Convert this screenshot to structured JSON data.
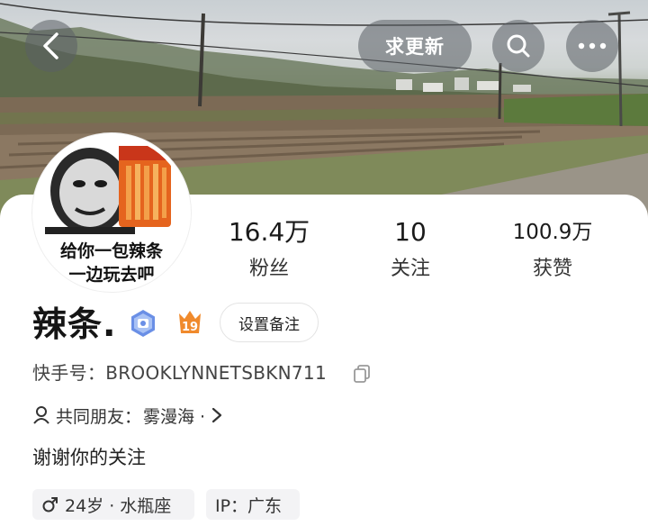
{
  "header": {
    "back_icon": "back-arrow-icon",
    "update_label": "求更新",
    "search_icon": "search-icon",
    "more_icon": "more-dots-icon"
  },
  "avatar": {
    "caption_line1": "给你一包辣条",
    "caption_line2": "一边玩去吧"
  },
  "stats": {
    "fans_value": "16.4万",
    "fans_label": "粉丝",
    "following_value": "10",
    "following_label": "关注",
    "likes_value": "100.9万",
    "likes_label": "获赞"
  },
  "profile": {
    "name": "辣条.",
    "level_badge": "19",
    "remark_button": "设置备注",
    "kwai_id_label": "快手号：",
    "kwai_id_value": "BROOKLYNNETSBKN711",
    "mutual_friends_label": "共同朋友：",
    "mutual_friends_value": "雾漫海 ·",
    "bio": "谢谢你的关注",
    "age_tag": "24岁 · 水瓶座",
    "ip_tag": "IP：广东"
  },
  "colors": {
    "accent_orange": "#f08a2c",
    "verified_blue": "#6a8fe6",
    "tag_bg": "#f3f3f5"
  }
}
